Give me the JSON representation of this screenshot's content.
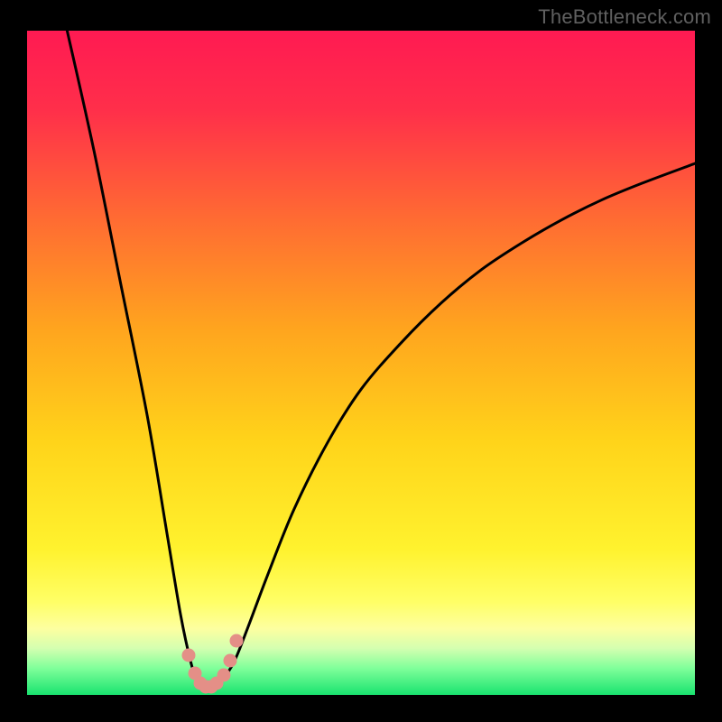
{
  "attribution": "TheBottleneck.com",
  "chart_data": {
    "type": "line",
    "title": "",
    "xlabel": "",
    "ylabel": "",
    "x_range": [
      0,
      100
    ],
    "y_range": [
      0,
      100
    ],
    "series": [
      {
        "name": "bottleneck-curve",
        "x": [
          6,
          10,
          14,
          18,
          21,
          23,
          24.5,
          25.5,
          26.5,
          27.5,
          29,
          31,
          33,
          36,
          40,
          45,
          50,
          56,
          62,
          68,
          74,
          80,
          86,
          92,
          100
        ],
        "y": [
          100,
          82,
          62,
          42,
          24,
          12,
          5,
          2,
          1,
          1,
          2,
          5,
          10,
          18,
          28,
          38,
          46,
          53,
          59,
          64,
          68,
          71.5,
          74.5,
          77,
          80
        ]
      }
    ],
    "markers": {
      "name": "highlight-dots",
      "x": [
        24.2,
        25.2,
        26.0,
        26.8,
        27.6,
        28.4,
        29.4,
        30.4,
        31.4
      ],
      "y": [
        6.0,
        3.3,
        1.8,
        1.2,
        1.2,
        1.8,
        3.0,
        5.2,
        8.2
      ]
    },
    "gradient_stops": [
      {
        "offset": 0.0,
        "color": "#ff1a52"
      },
      {
        "offset": 0.12,
        "color": "#ff2f4a"
      },
      {
        "offset": 0.28,
        "color": "#ff6a33"
      },
      {
        "offset": 0.45,
        "color": "#ffa51e"
      },
      {
        "offset": 0.62,
        "color": "#ffd41a"
      },
      {
        "offset": 0.78,
        "color": "#fff22e"
      },
      {
        "offset": 0.86,
        "color": "#ffff66"
      },
      {
        "offset": 0.9,
        "color": "#fdffa0"
      },
      {
        "offset": 0.93,
        "color": "#d4ffb0"
      },
      {
        "offset": 0.96,
        "color": "#7fff9a"
      },
      {
        "offset": 1.0,
        "color": "#19e36f"
      }
    ]
  }
}
